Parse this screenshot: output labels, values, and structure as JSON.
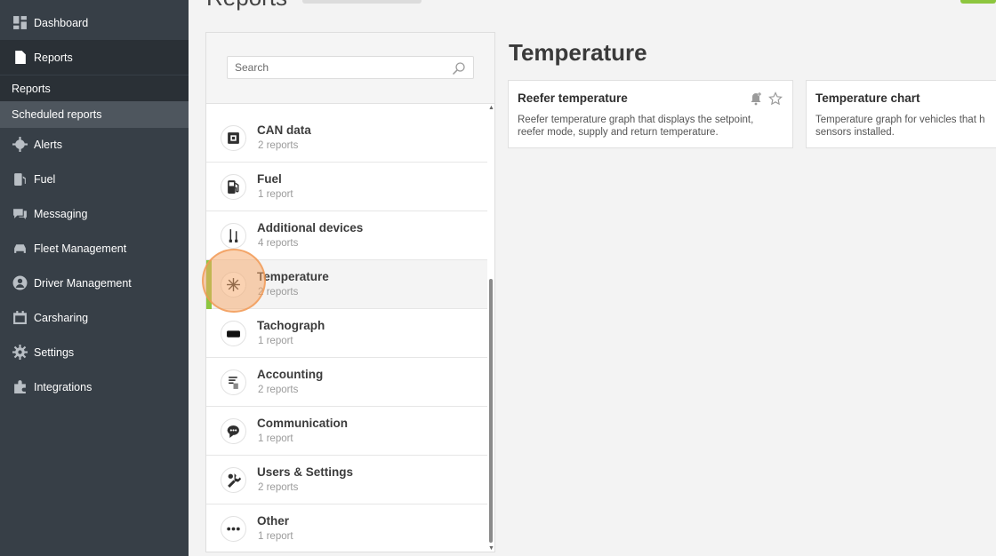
{
  "header": {
    "title": "Reports"
  },
  "sidebar": {
    "items": [
      {
        "label": "Dashboard",
        "icon": "dashboard-icon"
      },
      {
        "label": "Reports",
        "icon": "report-icon"
      },
      {
        "label": "Alerts",
        "icon": "alert-gear-icon"
      },
      {
        "label": "Fuel",
        "icon": "fuel-pump-icon"
      },
      {
        "label": "Messaging",
        "icon": "chat-icon"
      },
      {
        "label": "Fleet Management",
        "icon": "car-icon"
      },
      {
        "label": "Driver Management",
        "icon": "user-icon"
      },
      {
        "label": "Carsharing",
        "icon": "calendar-icon"
      },
      {
        "label": "Settings",
        "icon": "gear-icon"
      },
      {
        "label": "Integrations",
        "icon": "puzzle-icon"
      }
    ],
    "sub_items": [
      {
        "label": "Reports"
      },
      {
        "label": "Scheduled reports"
      }
    ]
  },
  "search": {
    "placeholder": "Search",
    "value": ""
  },
  "categories": [
    {
      "name": "CAN data",
      "count": "2 reports",
      "icon": "chip-icon"
    },
    {
      "name": "Fuel",
      "count": "1 report",
      "icon": "fuel-pump-icon"
    },
    {
      "name": "Additional devices",
      "count": "4 reports",
      "icon": "cables-icon"
    },
    {
      "name": "Temperature",
      "count": "2 reports",
      "icon": "snowflake-icon",
      "active": true
    },
    {
      "name": "Tachograph",
      "count": "1 report",
      "icon": "tachograph-icon"
    },
    {
      "name": "Accounting",
      "count": "2 reports",
      "icon": "document-icon"
    },
    {
      "name": "Communication",
      "count": "1 report",
      "icon": "chat-bubble-icon"
    },
    {
      "name": "Users & Settings",
      "count": "2 reports",
      "icon": "tools-icon"
    },
    {
      "name": "Other",
      "count": "1 report",
      "icon": "more-icon"
    }
  ],
  "main": {
    "section_title": "Temperature",
    "cards": [
      {
        "title": "Reefer temperature",
        "desc_line1": "Reefer temperature graph that displays the setpoint,",
        "desc_line2": "reefer mode, supply and return temperature."
      },
      {
        "title": "Temperature chart",
        "desc_line1": "Temperature graph for vehicles that h",
        "desc_line2": "sensors installed."
      }
    ]
  },
  "colors": {
    "sidebar_bg": "#373f47",
    "accent_green": "#8dc63f",
    "click_highlight": "#f5a666"
  }
}
